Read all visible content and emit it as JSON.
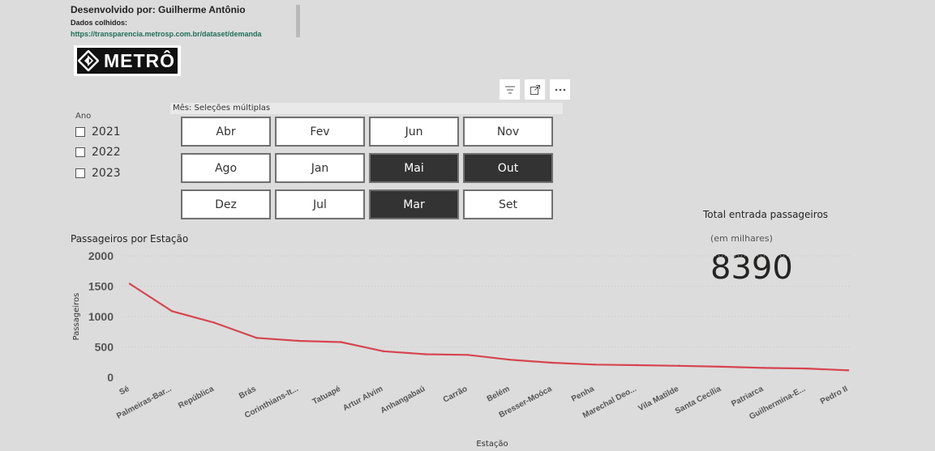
{
  "credits": {
    "author": "Desenvolvido por: Guilherme Antônio",
    "data_label": "Dados colhidos:",
    "link": "https://transparencia.metrosp.com.br/dataset/demanda"
  },
  "logo": {
    "text": "METRÔ",
    "icon": "metro-logo-icon"
  },
  "visual_toolbar": {
    "icons": [
      "filter-icon",
      "focus-mode-icon",
      "more-options-icon"
    ]
  },
  "year_slicer": {
    "label": "Ano",
    "items": [
      {
        "label": "2021",
        "checked": false
      },
      {
        "label": "2022",
        "checked": false
      },
      {
        "label": "2023",
        "checked": false
      }
    ]
  },
  "month_slicer": {
    "header": "Mês: Seleções múltiplas",
    "tiles": [
      {
        "label": "Abr",
        "selected": false
      },
      {
        "label": "Fev",
        "selected": false
      },
      {
        "label": "Jun",
        "selected": false
      },
      {
        "label": "Nov",
        "selected": false
      },
      {
        "label": "Ago",
        "selected": false
      },
      {
        "label": "Jan",
        "selected": false
      },
      {
        "label": "Mai",
        "selected": true
      },
      {
        "label": "Out",
        "selected": true
      },
      {
        "label": "Dez",
        "selected": false
      },
      {
        "label": "Jul",
        "selected": false
      },
      {
        "label": "Mar",
        "selected": true
      },
      {
        "label": "Set",
        "selected": false
      }
    ]
  },
  "kpi": {
    "title": "Total entrada passageiros",
    "subtitle": "(em milhares)",
    "value": "8390"
  },
  "colors": {
    "line": "#d64550",
    "selected_tile": "#333333",
    "background": "#dcdcdc"
  },
  "chart_data": {
    "type": "line",
    "title": "Passageiros por Estação",
    "xlabel": "Estação",
    "ylabel": "Passageiros",
    "ylim": [
      0,
      2000
    ],
    "yticks": [
      "0",
      "500",
      "1000",
      "1500",
      "2000"
    ],
    "grid": true,
    "categories": [
      "Sé",
      "Palmeiras-Bar...",
      "República",
      "Brás",
      "Corinthians-It...",
      "Tatuapé",
      "Artur Alvim",
      "Anhangabaú",
      "Carrão",
      "Belém",
      "Bresser-Moóca",
      "Penha",
      "Marechal Deo...",
      "Vila Matilde",
      "Santa Cecília",
      "Patriarca",
      "Guilhermina-E...",
      "Pedro II"
    ],
    "series": [
      {
        "values": [
          1540,
          1090,
          900,
          650,
          600,
          580,
          430,
          380,
          370,
          290,
          240,
          210,
          200,
          190,
          175,
          155,
          145,
          115
        ]
      }
    ]
  }
}
